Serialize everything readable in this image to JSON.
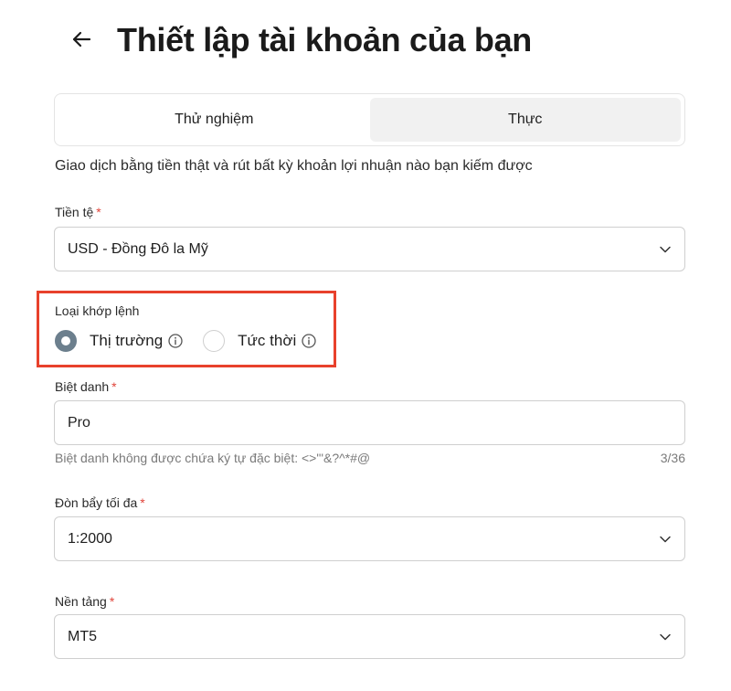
{
  "header": {
    "title": "Thiết lập tài khoản của bạn",
    "back_icon": "arrow-left-icon"
  },
  "tabs": [
    {
      "label": "Thử nghiệm",
      "active": false
    },
    {
      "label": "Thực",
      "active": true
    }
  ],
  "description": "Giao dịch bằng tiền thật và rút bất kỳ khoản lợi nhuận nào bạn kiếm được",
  "currency": {
    "label": "Tiền tệ",
    "required_mark": "*",
    "value": "USD - Đồng Đô la Mỹ"
  },
  "execution": {
    "label": "Loại khớp lệnh",
    "options": [
      {
        "label": "Thị trường",
        "selected": true
      },
      {
        "label": "Tức thời",
        "selected": false
      }
    ],
    "highlight_color": "#e8412c"
  },
  "nickname": {
    "label": "Biệt danh",
    "required_mark": "*",
    "value": "Pro",
    "helper": "Biệt danh không được chứa ký tự đặc biệt: <>\"'&?^*#@",
    "counter": "3/36"
  },
  "leverage": {
    "label": "Đòn bẩy tối đa",
    "required_mark": "*",
    "value": "1:2000"
  },
  "platform": {
    "label": "Nền tảng",
    "required_mark": "*",
    "value": "MT5"
  },
  "colors": {
    "required": "#e0443a",
    "radio_checked": "#6c7f8d",
    "tab_active_bg": "#f1f1f1"
  }
}
